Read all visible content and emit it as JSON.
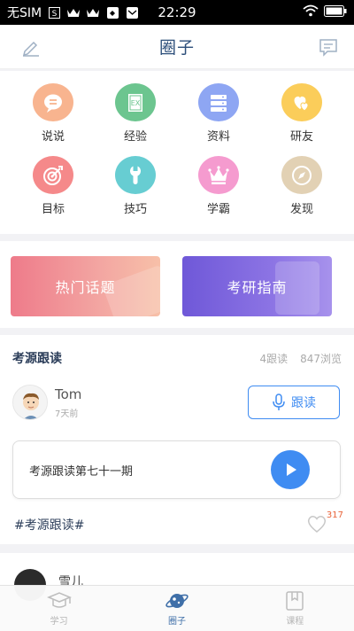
{
  "status_bar": {
    "carrier": "无SIM",
    "time": "22:29"
  },
  "header": {
    "title": "圈子"
  },
  "categories": [
    {
      "label": "说说",
      "color": "#f8b48f",
      "icon": "chat-bubble-icon"
    },
    {
      "label": "经验",
      "color": "#6cc58f",
      "icon": "book-ex-icon"
    },
    {
      "label": "资料",
      "color": "#8ea6f3",
      "icon": "server-stack-icon"
    },
    {
      "label": "研友",
      "color": "#fbcd5a",
      "icon": "hearts-icon"
    },
    {
      "label": "目标",
      "color": "#f5898a",
      "icon": "target-icon"
    },
    {
      "label": "技巧",
      "color": "#67cdd2",
      "icon": "wrench-icon"
    },
    {
      "label": "学霸",
      "color": "#f59bcf",
      "icon": "crown-icon"
    },
    {
      "label": "发现",
      "color": "#e2d1b4",
      "icon": "compass-icon"
    }
  ],
  "banners": {
    "hot": "热门话题",
    "guide": "考研指南"
  },
  "post": {
    "title": "考源跟读",
    "follows": "4跟读",
    "views": "847浏览",
    "author": "Tom",
    "time_ago": "7天前",
    "follow_button": "跟读",
    "audio_title": "考源跟读第七十一期",
    "tag": "#考源跟读#",
    "likes": "317"
  },
  "next_post": {
    "author": "雪儿"
  },
  "tabbar": [
    {
      "label": "学习",
      "icon": "mortarboard-icon",
      "active": false
    },
    {
      "label": "圈子",
      "icon": "planet-icon",
      "active": true
    },
    {
      "label": "课程",
      "icon": "bookmark-icon",
      "active": false
    }
  ],
  "colors": {
    "accent": "#3f8cf2",
    "title": "#2c4e7a",
    "like_count": "#e8643a"
  }
}
